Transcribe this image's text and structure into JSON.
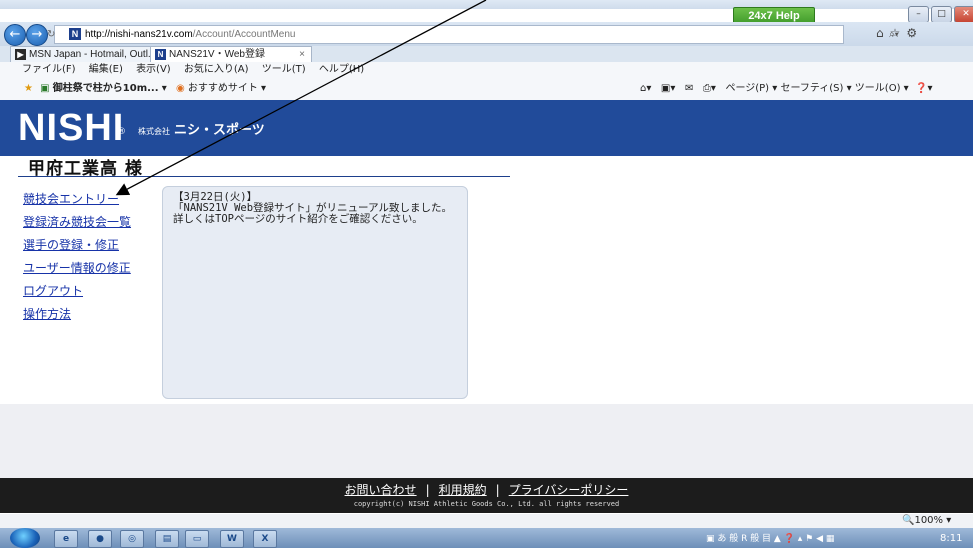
{
  "browser": {
    "help_badge": "24x7 Help",
    "address": {
      "host": "http://nishi-nans21v.com",
      "path": "/Account/AccountMenu",
      "site_icon": "N"
    },
    "tabs": [
      {
        "label": "MSN Japan - Hotmail, Outl...",
        "icon": "msn-icon"
      },
      {
        "label": "NANS21V・Web登録",
        "icon": "N",
        "close": "×"
      }
    ],
    "menu": [
      "ファイル(F)",
      "編集(E)",
      "表示(V)",
      "お気に入り(A)",
      "ツール(T)",
      "ヘルプ(H)"
    ],
    "favorites": {
      "item1": "御柱祭で柱から10m...",
      "item2": "おすすめサイト"
    },
    "command_bar": "ページ(P) ▾   セーフティ(S) ▾   ツール(O) ▾",
    "zoom": "100%"
  },
  "site": {
    "logo": "NISHI",
    "logo_mark": "®",
    "company_prefix": "株式会社",
    "company_name": "ニシ・スポーツ",
    "school_name": "甲府工業高 様"
  },
  "menu_links": [
    "競技会エントリー",
    "登録済み競技会一覧",
    "選手の登録・修正",
    "ユーザー情報の修正",
    "ログアウト",
    "操作方法"
  ],
  "notice": {
    "date": "【3月22日(火)】",
    "body": "「NANS21V Web登録サイト」がリニューアル致しました。詳しくはTOPページのサイト紹介をご確認ください。"
  },
  "footer": {
    "links": [
      "お問い合わせ",
      "利用規約",
      "プライバシーポリシー"
    ],
    "separator": "|",
    "copyright": "copyright(c) NISHI Athletic Goods Co., Ltd. all rights reserved"
  },
  "taskbar": {
    "clock": "8:11"
  },
  "colors": {
    "header_blue": "#214b9a",
    "link_blue": "#1733a8",
    "footer_bg": "#1c1c1c",
    "notice_bg": "#e7ecf4"
  }
}
